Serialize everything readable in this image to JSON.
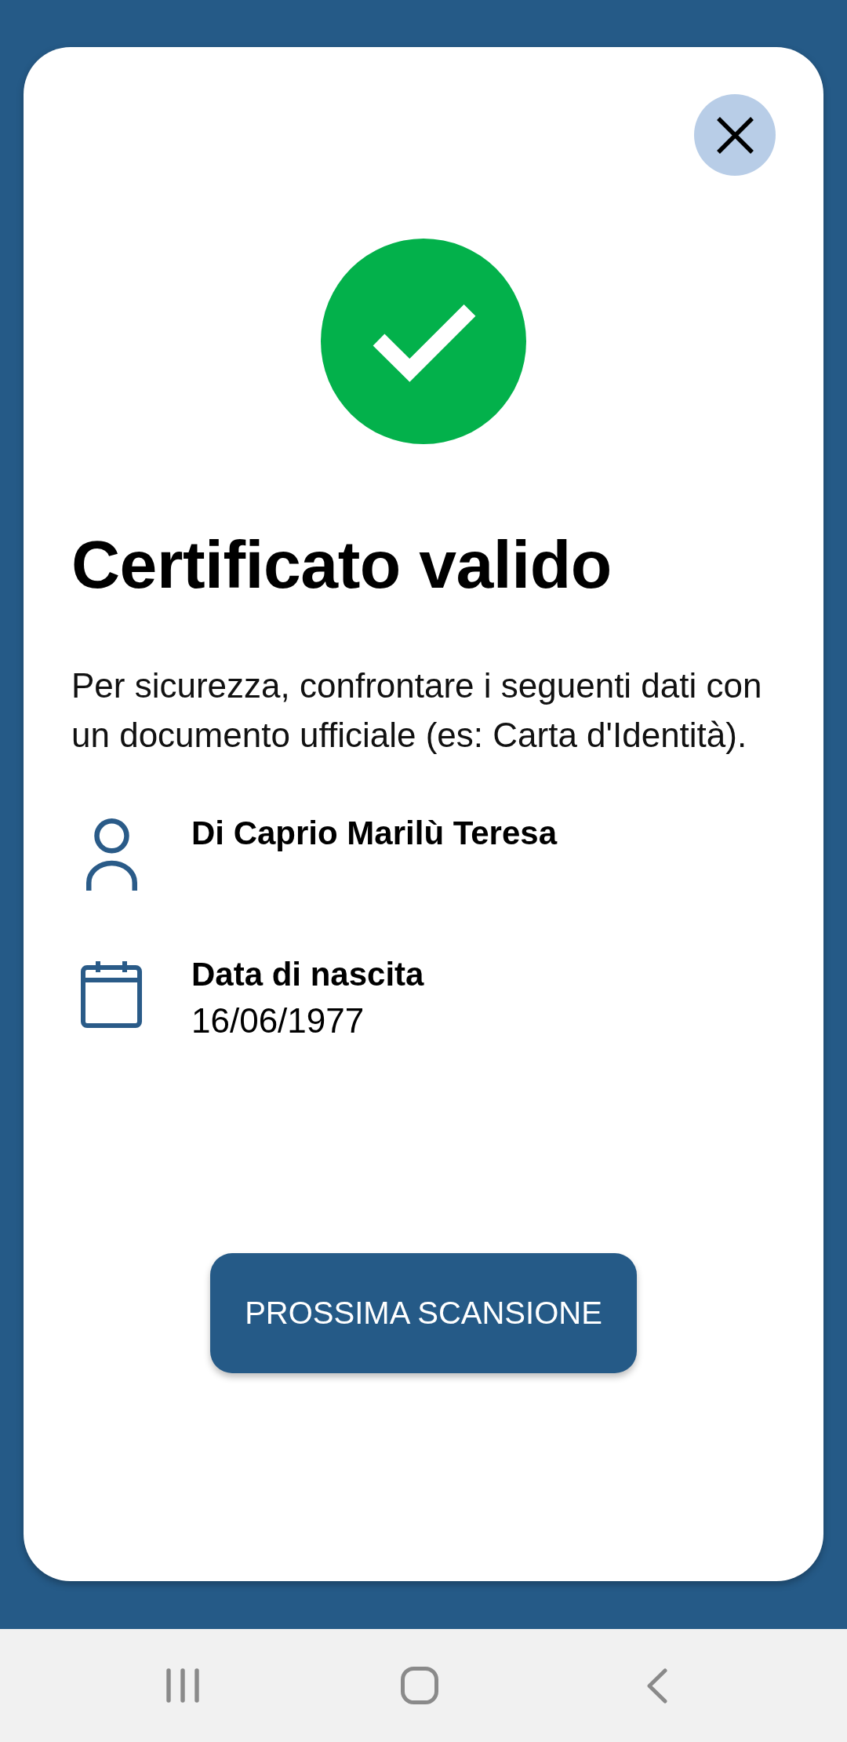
{
  "dialog": {
    "result": {
      "kind": "valid",
      "title": "Certificato valido",
      "message": "Per sicurezza, confrontare i seguenti dati con un documento ufficiale (es: Carta d'Identità)."
    },
    "details": [
      {
        "kind": "person",
        "label": "Di Caprio Marilù Teresa"
      },
      {
        "kind": "birth_date",
        "label": "Data di nascita",
        "value": "16/06/1977"
      }
    ],
    "next_button": {
      "label": "PROSSIMA SCANSIONE"
    }
  }
}
